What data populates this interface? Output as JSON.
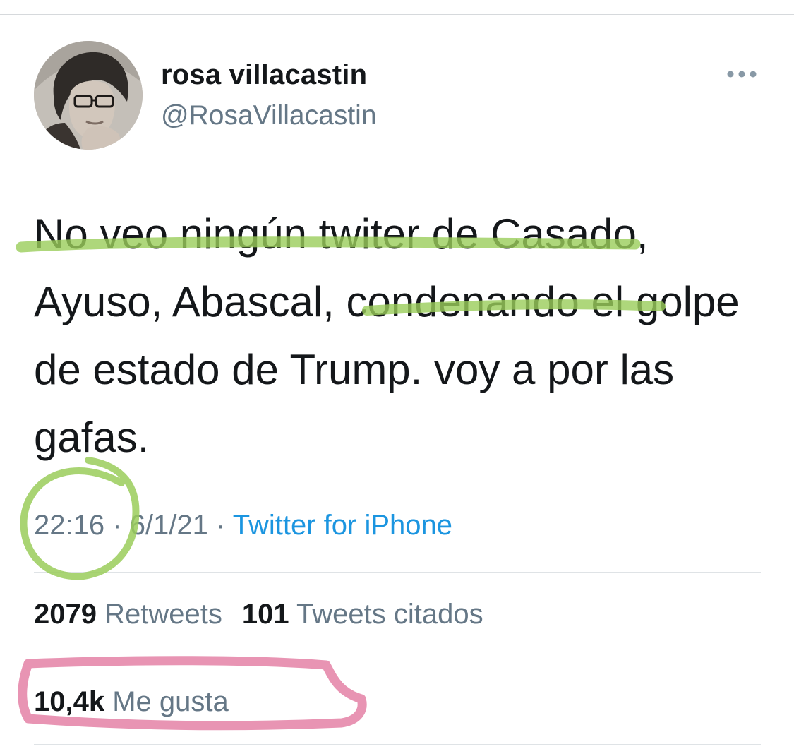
{
  "tweet": {
    "author": {
      "display_name": "rosa villacastin",
      "handle": "@RosaVillacastin",
      "avatar_icon": "profile-photo"
    },
    "more_icon": "more-horizontal-icon",
    "text": "No veo ningún twiter de Casado, Ayuso, Abascal, condenando el golpe de estado de Trump. voy a por las gafas.",
    "time": "22:16",
    "separator": "·",
    "date": "6/1/21",
    "source": "Twitter for iPhone",
    "stats": {
      "retweets_count": "2079",
      "retweets_label": "Retweets",
      "quotes_count": "101",
      "quotes_label": "Tweets citados",
      "likes_count": "10,4k",
      "likes_label": "Me gusta"
    }
  },
  "colors": {
    "text": "#14171a",
    "muted": "#657786",
    "link": "#1b95e0",
    "highlight_green": "#9acd5a",
    "highlight_pink": "#e0709a"
  }
}
